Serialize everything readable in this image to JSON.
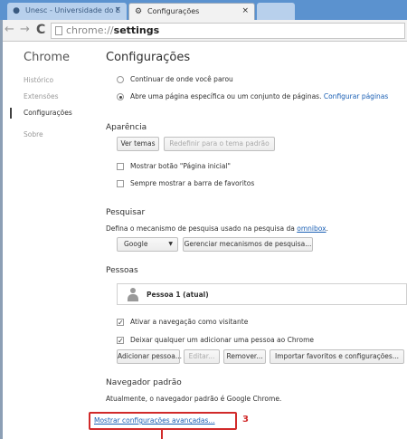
{
  "browser": {
    "tabs": [
      {
        "title": "Unesc - Universidade do E"
      },
      {
        "title": "Configurações"
      }
    ],
    "url_scheme": "chrome://",
    "url_host": "settings"
  },
  "sidebar": {
    "title": "Chrome",
    "items": [
      "Histórico",
      "Extensões",
      "Configurações",
      "Sobre"
    ]
  },
  "main": {
    "title": "Configurações",
    "startup": {
      "option1": "Continuar de onde você parou",
      "option2": "Abre uma página específica ou um conjunto de páginas.",
      "option2_link": "Configurar páginas"
    },
    "appearance": {
      "title": "Aparência",
      "themes_btn": "Ver temas",
      "reset_btn": "Redefinir para o tema padrão",
      "home_btn_label": "Mostrar botão \"Página inicial\"",
      "bookmarks_bar_label": "Sempre mostrar a barra de favoritos"
    },
    "search": {
      "title": "Pesquisar",
      "desc": "Defina o mecanismo de pesquisa usado na pesquisa da",
      "desc_link": "omnibox",
      "engine": "Google",
      "manage_btn": "Gerenciar mecanismos de pesquisa..."
    },
    "people": {
      "title": "Pessoas",
      "profile_name": "Pessoa 1 (atual)",
      "guest_label": "Ativar a navegação como visitante",
      "anyone_label": "Deixar qualquer um adicionar uma pessoa ao Chrome",
      "add_btn": "Adicionar pessoa...",
      "edit_btn": "Editar...",
      "remove_btn": "Remover...",
      "import_btn": "Importar favoritos e configurações..."
    },
    "default_browser": {
      "title": "Navegador padrão",
      "desc": "Atualmente, o navegador padrão é Google Chrome."
    },
    "advanced_link": "Mostrar configurações avançadas...",
    "step_number": "3"
  },
  "colors": {
    "highlight": "#d12a2a",
    "link": "#1a5fb4",
    "tabbar": "#5b92cf"
  }
}
